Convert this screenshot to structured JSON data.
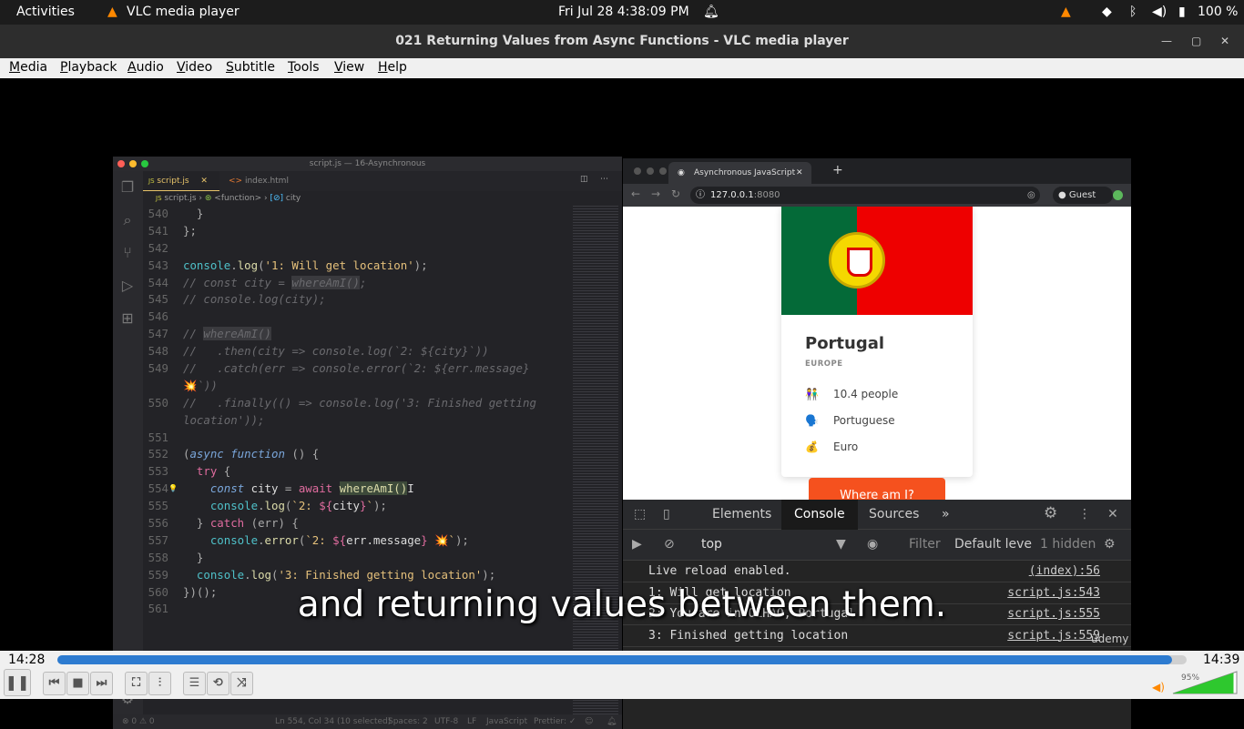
{
  "topbar": {
    "activities": "Activities",
    "app": "VLC media player",
    "clock": "Fri Jul 28   4:38:09 PM",
    "battery": "100 %"
  },
  "window": {
    "title": "021 Returning Values from Async Functions - VLC media player"
  },
  "menu": [
    "Media",
    "Playback",
    "Audio",
    "Video",
    "Subtitle",
    "Tools",
    "View",
    "Help"
  ],
  "vscode": {
    "title": "script.js — 16-Asynchronous",
    "tabs": [
      {
        "label": "script.js",
        "icon": "JS"
      },
      {
        "label": "index.html",
        "icon": "<>"
      }
    ],
    "breadcrumb": [
      "script.js",
      "<function>",
      "city"
    ],
    "status": {
      "problems": "⊗ 0 ⚠ 0",
      "position": "Ln 554, Col 34 (10 selected)",
      "spaces": "Spaces: 2",
      "encoding": "UTF-8",
      "eol": "LF",
      "language": "JavaScript",
      "prettier": "Prettier: ✓"
    },
    "lines": [
      {
        "n": "540",
        "t": [
          [
            "  }",
            "pu"
          ]
        ]
      },
      {
        "n": "541",
        "t": [
          [
            "};",
            "pu"
          ]
        ]
      },
      {
        "n": "542",
        "t": []
      },
      {
        "n": "543",
        "t": [
          [
            "console",
            "cn"
          ],
          [
            ".",
            "pu"
          ],
          [
            "log",
            "fn"
          ],
          [
            "(",
            "pu"
          ],
          [
            "'1: Will get location'",
            "st"
          ],
          [
            ");",
            "pu"
          ]
        ]
      },
      {
        "n": "544",
        "t": [
          [
            "// const city = ",
            "cm"
          ],
          [
            "whereAmI()",
            "cm hl"
          ],
          [
            ";",
            "cm"
          ]
        ]
      },
      {
        "n": "545",
        "t": [
          [
            "// console.log(city);",
            "cm"
          ]
        ]
      },
      {
        "n": "546",
        "t": []
      },
      {
        "n": "547",
        "t": [
          [
            "// ",
            "cm"
          ],
          [
            "whereAmI()",
            "cm hl"
          ]
        ]
      },
      {
        "n": "548",
        "t": [
          [
            "//   .then(city => console.log(`2: ${city}`))",
            "cm"
          ]
        ]
      },
      {
        "n": "549",
        "t": [
          [
            "//   .catch(err => console.error(`2: ${err.message}",
            "cm"
          ]
        ]
      },
      {
        "n": "",
        "t": [
          [
            "💥",
            "em"
          ],
          [
            "`))",
            "cm"
          ]
        ]
      },
      {
        "n": "550",
        "t": [
          [
            "//   .finally(() => console.log('3: Finished getting",
            "cm"
          ]
        ]
      },
      {
        "n": "",
        "t": [
          [
            "location'));",
            "cm"
          ]
        ]
      },
      {
        "n": "551",
        "t": []
      },
      {
        "n": "552",
        "t": [
          [
            "(",
            "pu"
          ],
          [
            "async function",
            "kw"
          ],
          [
            " () {",
            "pu"
          ]
        ]
      },
      {
        "n": "553",
        "t": [
          [
            "  ",
            "pu"
          ],
          [
            "try",
            "kc"
          ],
          [
            " {",
            "pu"
          ]
        ]
      },
      {
        "n": "554",
        "t": [
          [
            "    ",
            "pu"
          ],
          [
            "const",
            "kw"
          ],
          [
            " city ",
            "va"
          ],
          [
            "= ",
            "pu"
          ],
          [
            "await",
            "kc"
          ],
          [
            " ",
            "pu"
          ],
          [
            "whereAmI()",
            "fn hl2"
          ]
        ]
      },
      {
        "n": "555",
        "t": [
          [
            "    ",
            "pu"
          ],
          [
            "console",
            "cn"
          ],
          [
            ".",
            "pu"
          ],
          [
            "log",
            "fn"
          ],
          [
            "(",
            "pu"
          ],
          [
            "`2: ",
            "st"
          ],
          [
            "${",
            "kc"
          ],
          [
            "city",
            "va"
          ],
          [
            "}",
            "kc"
          ],
          [
            "`",
            "st"
          ],
          [
            ");",
            "pu"
          ]
        ]
      },
      {
        "n": "556",
        "t": [
          [
            "  } ",
            "pu"
          ],
          [
            "catch",
            "kc"
          ],
          [
            " (err) {",
            "pu"
          ]
        ]
      },
      {
        "n": "557",
        "t": [
          [
            "    ",
            "pu"
          ],
          [
            "console",
            "cn"
          ],
          [
            ".",
            "pu"
          ],
          [
            "error",
            "fn"
          ],
          [
            "(",
            "pu"
          ],
          [
            "`2: ",
            "st"
          ],
          [
            "${",
            "kc"
          ],
          [
            "err.message",
            "va"
          ],
          [
            "}",
            "kc"
          ],
          [
            " 💥",
            "em"
          ],
          [
            "`",
            "st"
          ],
          [
            ");",
            "pu"
          ]
        ]
      },
      {
        "n": "558",
        "t": [
          [
            "  }",
            "pu"
          ]
        ]
      },
      {
        "n": "559",
        "t": [
          [
            "  ",
            "pu"
          ],
          [
            "console",
            "cn"
          ],
          [
            ".",
            "pu"
          ],
          [
            "log",
            "fn"
          ],
          [
            "(",
            "pu"
          ],
          [
            "'3: Finished getting location'",
            "st"
          ],
          [
            ");",
            "pu"
          ]
        ]
      },
      {
        "n": "560",
        "t": [
          [
            "})();",
            "pu"
          ]
        ]
      },
      {
        "n": "561",
        "t": []
      }
    ]
  },
  "browser": {
    "tab": "Asynchronous JavaScript",
    "url_host": "127.0.0.1",
    "url_port": ":8080",
    "profile": "Guest",
    "card": {
      "country": "Portugal",
      "region": "EUROPE",
      "facts": [
        {
          "icon": "👫",
          "text": "10.4 people"
        },
        {
          "icon": "🗣️",
          "text": "Portuguese"
        },
        {
          "icon": "💰",
          "text": "Euro"
        }
      ]
    },
    "button": "Where am I?",
    "devtools": {
      "tabs": [
        "Elements",
        "Console",
        "Sources",
        "»"
      ],
      "active": "Console",
      "context": "top",
      "filter": "Filter",
      "levels": "Default levels",
      "hidden": "1 hidden",
      "messages": [
        {
          "text": "Live reload enabled.",
          "src": "(index):56"
        },
        {
          "text": "1: Will get location",
          "src": "script.js:543"
        },
        {
          "text": "2: You are in OLHÃO, Portugal",
          "src": "script.js:555"
        },
        {
          "text": "3: Finished getting location",
          "src": "script.js:559"
        }
      ],
      "prompt": ">"
    }
  },
  "subtitle": "and returning values between them.",
  "watermark": "ûdemy",
  "player": {
    "elapsed": "14:28",
    "total": "14:39",
    "progress": 0.987,
    "volume": "95%",
    "volume_level": 0.95
  }
}
